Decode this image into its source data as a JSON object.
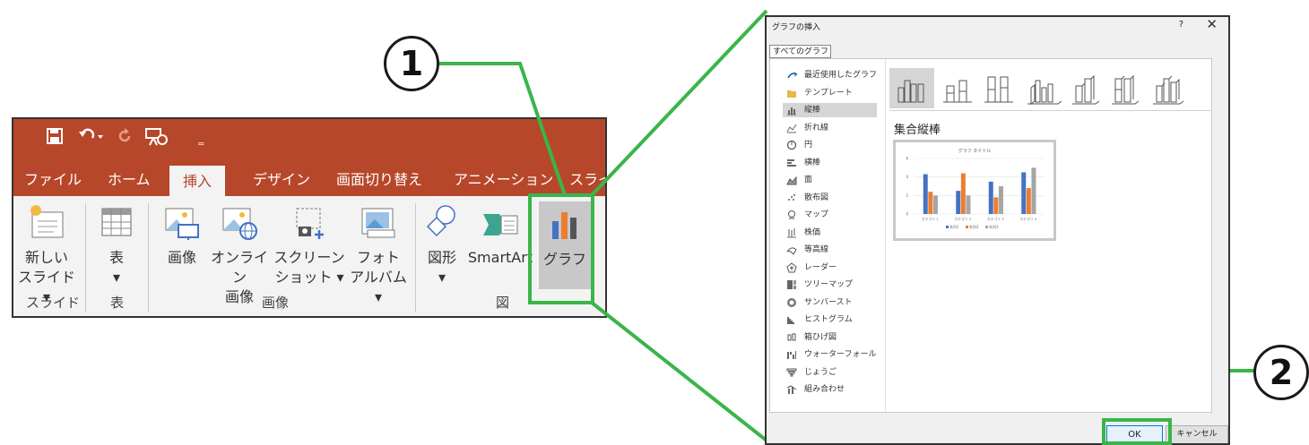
{
  "ribbon": {
    "tabs": [
      "ファイル",
      "ホーム",
      "挿入",
      "デザイン",
      "画面切り替え",
      "アニメーション",
      "スライ"
    ],
    "active_tab_index": 2,
    "buttons": {
      "new_slide": "新しい\nスライド ▾",
      "table": "表\n▾",
      "picture": "画像",
      "online_picture": "オンライン\n画像",
      "screenshot": "スクリーン\nショット ▾",
      "photo_album": "フォト\nアルバム ▾",
      "shapes": "図形\n▾",
      "smartart": "SmartArt",
      "chart": "グラフ"
    },
    "groups": {
      "slides": "スライド",
      "tables": "表",
      "images": "画像",
      "illustrations": "図"
    },
    "colors": {
      "accent": "#b7472a",
      "highlight": "#3ab54a"
    }
  },
  "dialog": {
    "title": "グラフの挿入",
    "help": "?",
    "close": "✕",
    "tab": "すべてのグラフ",
    "nav": [
      {
        "label": "最近使用したグラフ",
        "icon": "recent-icon"
      },
      {
        "label": "テンプレート",
        "icon": "folder-icon"
      },
      {
        "label": "縦棒",
        "icon": "column-chart-icon"
      },
      {
        "label": "折れ線",
        "icon": "line-chart-icon"
      },
      {
        "label": "円",
        "icon": "pie-chart-icon"
      },
      {
        "label": "横棒",
        "icon": "bar-chart-icon"
      },
      {
        "label": "面",
        "icon": "area-chart-icon"
      },
      {
        "label": "散布図",
        "icon": "scatter-chart-icon"
      },
      {
        "label": "マップ",
        "icon": "map-chart-icon"
      },
      {
        "label": "株価",
        "icon": "stock-chart-icon"
      },
      {
        "label": "等高線",
        "icon": "surface-chart-icon"
      },
      {
        "label": "レーダー",
        "icon": "radar-chart-icon"
      },
      {
        "label": "ツリーマップ",
        "icon": "treemap-chart-icon"
      },
      {
        "label": "サンバースト",
        "icon": "sunburst-chart-icon"
      },
      {
        "label": "ヒストグラム",
        "icon": "histogram-chart-icon"
      },
      {
        "label": "箱ひげ図",
        "icon": "boxwhisker-chart-icon"
      },
      {
        "label": "ウォーターフォール",
        "icon": "waterfall-chart-icon"
      },
      {
        "label": "じょうご",
        "icon": "funnel-chart-icon"
      },
      {
        "label": "組み合わせ",
        "icon": "combo-chart-icon"
      }
    ],
    "selected_nav_index": 2,
    "subtype_title": "集合縦棒",
    "ok_label": "OK",
    "cancel_label": "キャンセル"
  },
  "chart_data": {
    "type": "bar",
    "title": "グラフ タイトル",
    "categories": [
      "カテゴリ 1",
      "カテゴリ 2",
      "カテゴリ 3",
      "カテゴリ 4"
    ],
    "series": [
      {
        "name": "系列1",
        "values": [
          4.3,
          2.5,
          3.5,
          4.5
        ],
        "color": "#4472c4"
      },
      {
        "name": "系列2",
        "values": [
          2.4,
          4.4,
          1.8,
          2.8
        ],
        "color": "#ed7d31"
      },
      {
        "name": "系列3",
        "values": [
          2.0,
          2.0,
          3.0,
          5.0
        ],
        "color": "#a5a5a5"
      }
    ],
    "ylim": [
      0,
      6
    ],
    "yticks": [
      "0",
      "2",
      "4",
      "6"
    ],
    "legend": "bottom",
    "grid": true
  },
  "callouts": {
    "one": "1",
    "two": "2"
  }
}
